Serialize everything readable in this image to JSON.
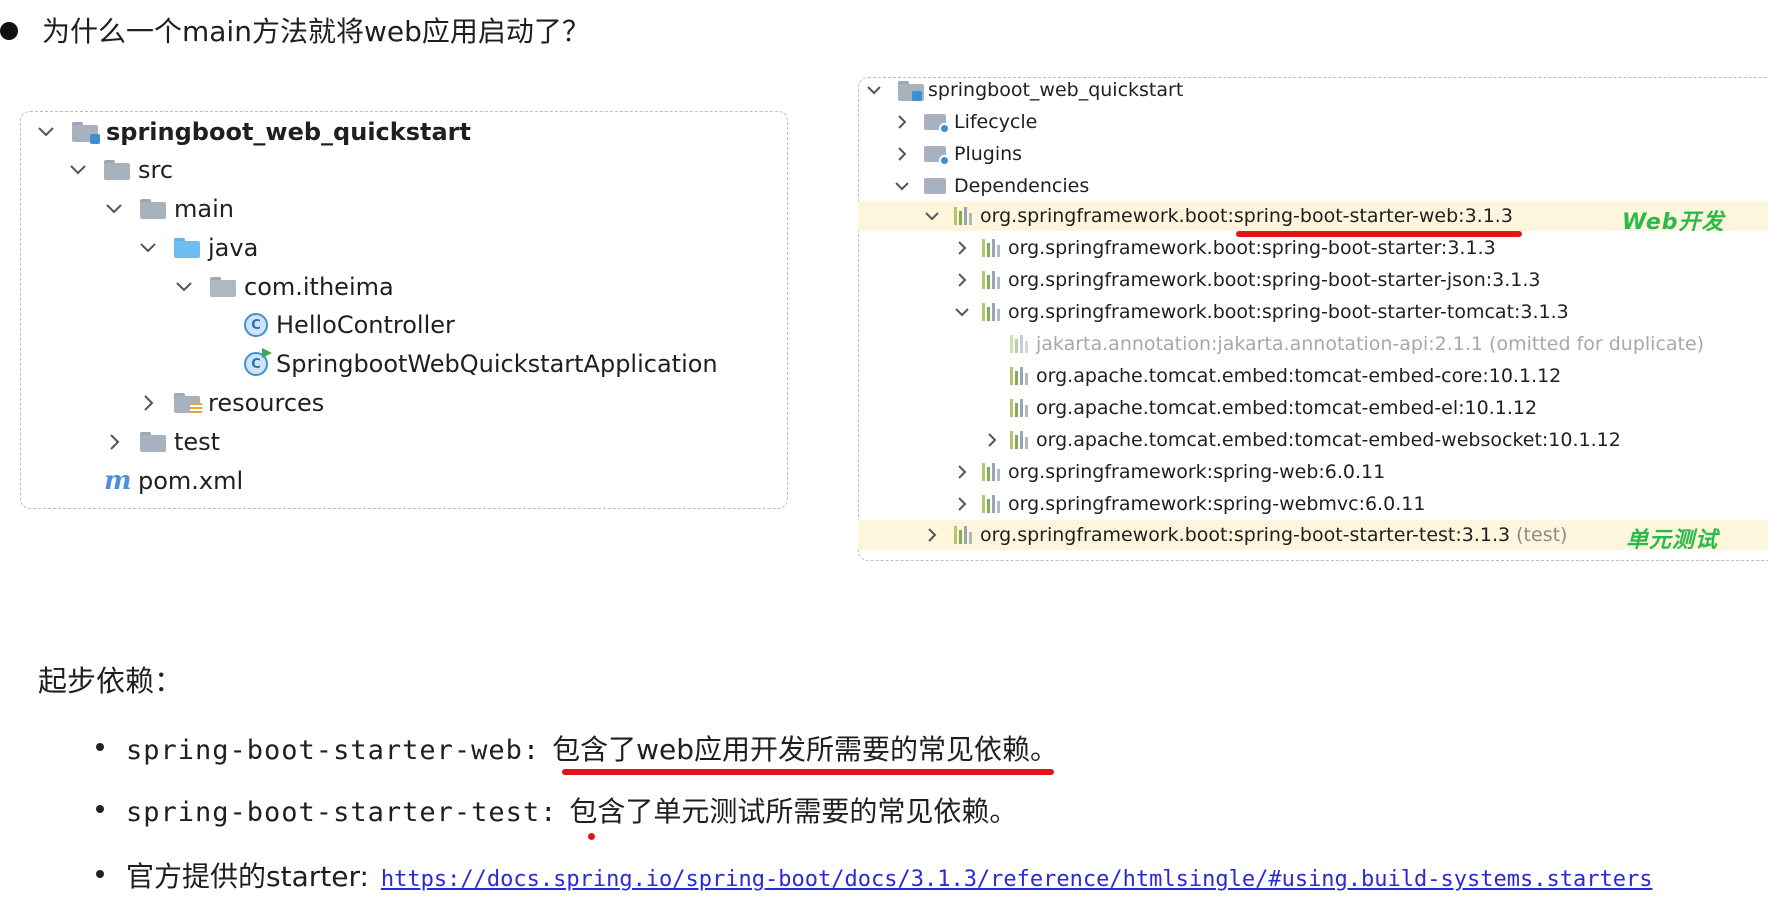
{
  "title": "为什么一个main方法就将web应用启动了？",
  "left_tree": {
    "root": "springboot_web_quickstart",
    "src": "src",
    "main": "main",
    "java": "java",
    "package": "com.itheima",
    "class1": "HelloController",
    "class2": "SpringbootWebQuickstartApplication",
    "resources": "resources",
    "test": "test",
    "pom": "pom.xml"
  },
  "right_tree": {
    "root": "springboot_web_quickstart",
    "lifecycle": "Lifecycle",
    "plugins": "Plugins",
    "dependencies": "Dependencies",
    "deps": [
      {
        "label": "org.springframework.boot:spring-boot-starter-web:3.1.3"
      },
      {
        "label": "org.springframework.boot:spring-boot-starter:3.1.3"
      },
      {
        "label": "org.springframework.boot:spring-boot-starter-json:3.1.3"
      },
      {
        "label": "org.springframework.boot:spring-boot-starter-tomcat:3.1.3"
      },
      {
        "label": "jakarta.annotation:jakarta.annotation-api:2.1.1 (omitted for duplicate)"
      },
      {
        "label": "org.apache.tomcat.embed:tomcat-embed-core:10.1.12"
      },
      {
        "label": "org.apache.tomcat.embed:tomcat-embed-el:10.1.12"
      },
      {
        "label": "org.apache.tomcat.embed:tomcat-embed-websocket:10.1.12"
      },
      {
        "label": "org.springframework:spring-web:6.0.11"
      },
      {
        "label": "org.springframework:spring-webmvc:6.0.11"
      },
      {
        "label": "org.springframework.boot:spring-boot-starter-test:3.1.3",
        "tag": "(test)"
      }
    ],
    "annotation_web": "Web开发",
    "annotation_test": "单元测试"
  },
  "section_title": "起步依赖：",
  "items": [
    {
      "code": "spring-boot-starter-web:",
      "text": "包含了web应用开发所需要的常见依赖。"
    },
    {
      "code": "spring-boot-starter-test:",
      "text": "包含了单元测试所需要的常见依赖。"
    },
    {
      "code": "官方提供的starter:",
      "text": "https://docs.spring.io/spring-boot/docs/3.1.3/reference/htmlsingle/#using.build-systems.starters"
    }
  ],
  "colors": {
    "highlight": "#fdf6dc",
    "underline": "#e0141a",
    "annotation": "#2bb94a",
    "link": "#2a2ad8"
  }
}
